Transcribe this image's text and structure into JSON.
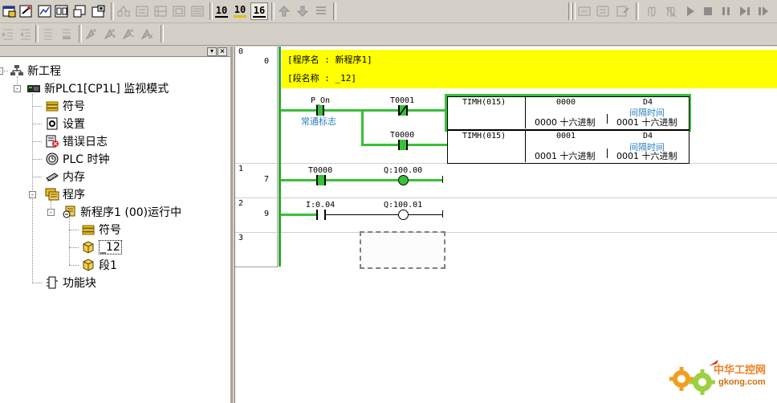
{
  "toolbar": {
    "num_buttons": [
      "10",
      "10",
      "16"
    ]
  },
  "tree": {
    "project": "新工程",
    "plc": "新PLC1[CP1L] 监视模式",
    "items": [
      "符号",
      "设置",
      "错误日志",
      "PLC 时钟",
      "内存",
      "程序"
    ],
    "program": "新程序1 (00)运行中",
    "program_items": [
      "符号",
      "_12",
      "段1"
    ],
    "function_block": "功能块"
  },
  "ladder": {
    "rungs": [
      {
        "index": "0",
        "step": "0"
      },
      {
        "index": "1",
        "step": "7"
      },
      {
        "index": "2",
        "step": "9"
      },
      {
        "index": "3",
        "step": ""
      }
    ],
    "header": {
      "program_name": "[程序名 : 新程序1]",
      "section_name": "[段名称 : _12]",
      "bg_color": "#ffff00"
    },
    "rung0": {
      "contact1": "P_On",
      "contact1_comment": "常通标志",
      "contact2": "T0001",
      "contact3": "T0000",
      "timer1": {
        "instr": "TIMH(015)",
        "number": "0000",
        "number_value": "0000 十六进制",
        "set_label": "D4",
        "set_comment": "间隔时间",
        "set_value": "0001 十六进制"
      },
      "timer2": {
        "instr": "TIMH(015)",
        "number": "0001",
        "number_value": "0001 十六进制",
        "set_label": "D4",
        "set_comment": "间隔时间",
        "set_value": "0001 十六进制"
      }
    },
    "rung1": {
      "contact": "T0000",
      "coil": "Q:100.00"
    },
    "rung2": {
      "contact": "I:0.04",
      "coil": "Q:100.01"
    },
    "energized_color": "#38c038"
  },
  "watermark": {
    "text": "中华工控网",
    "url": "gkong.com"
  }
}
